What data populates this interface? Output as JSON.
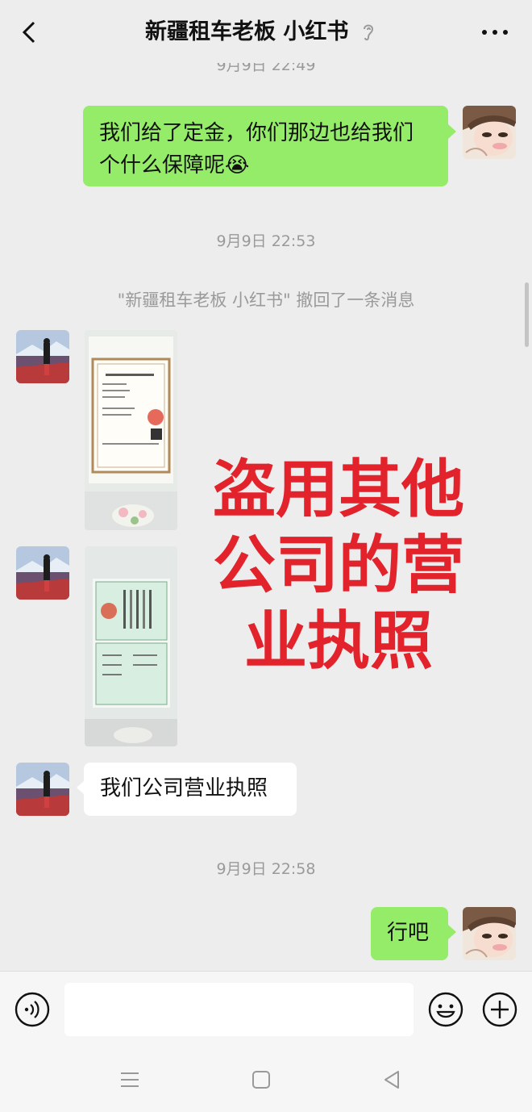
{
  "header": {
    "title": "新疆租车老板 小红书",
    "back_icon": "chevron-left-icon",
    "ear_icon": "ear-icon",
    "more_icon": "more-dots-icon"
  },
  "messages": {
    "ts_top": "9月9日 22:49",
    "msg1": "我们给了定金，你们那边也给我们个什么保障呢",
    "msg1_emoji": "😭",
    "ts2": "9月9日 22:53",
    "recall": "\"新疆租车老板 小红书\" 撤回了一条消息",
    "msg4": "我们公司营业执照",
    "ts3": "9月9日 22:58",
    "msg5": "行吧"
  },
  "overlay": {
    "line1": "盗用其他",
    "line2": "公司的营",
    "line3": "业执照",
    "color": "#e3232c"
  },
  "input": {
    "voice_icon": "voice-icon",
    "emoji_icon": "emoji-icon",
    "plus_icon": "plus-icon"
  },
  "nav": {
    "menu_icon": "menu-icon",
    "home_icon": "home-square-icon",
    "back_icon": "triangle-back-icon"
  },
  "colors": {
    "bubble_green": "#95ec69",
    "bubble_white": "#ffffff",
    "background": "#ededed"
  }
}
